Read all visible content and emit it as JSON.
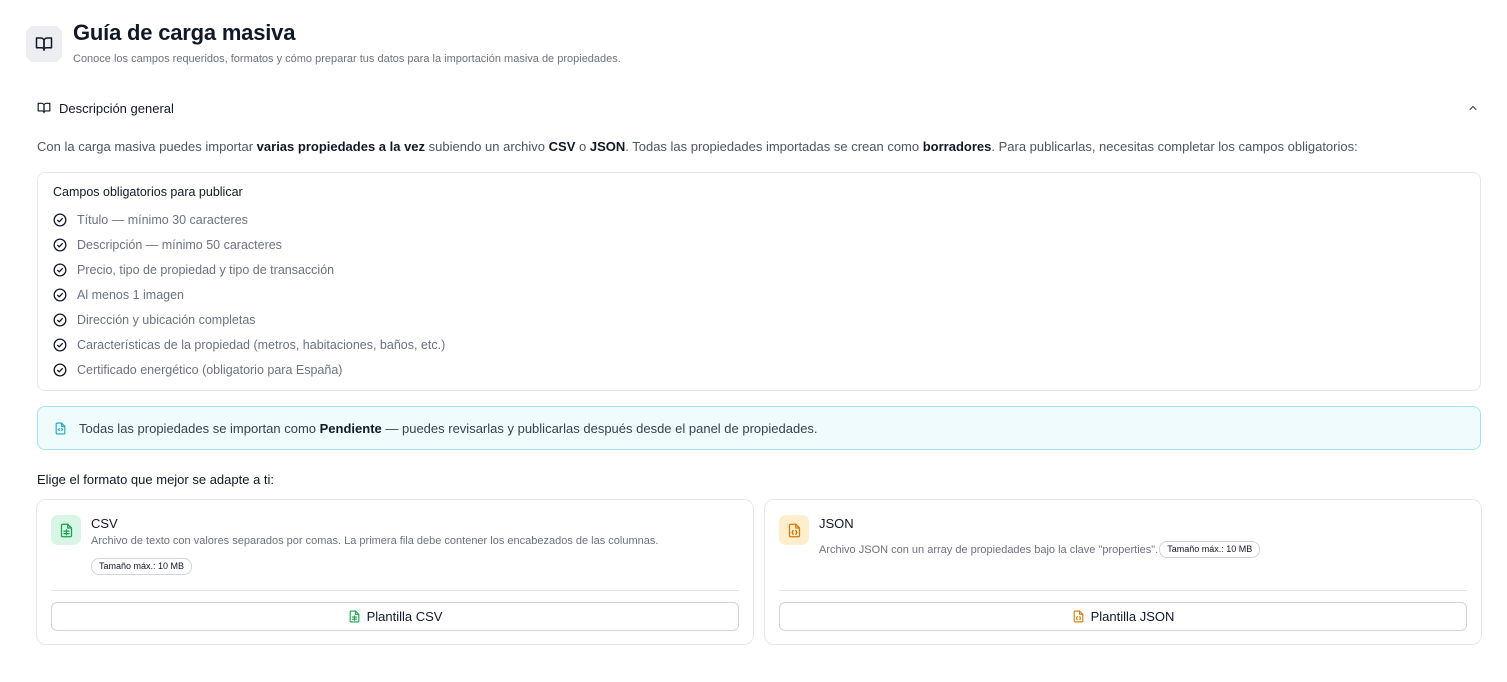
{
  "header": {
    "icon": "book-open-icon",
    "title": "Guía de carga masiva",
    "subtitle": "Conoce los campos requeridos, formatos y cómo preparar tus datos para la importación masiva de propiedades."
  },
  "section": {
    "icon": "book-open-icon",
    "title": "Descripción general",
    "toggle_icon": "chevron-up-icon"
  },
  "intro": {
    "t1": "Con la carga masiva puedes importar ",
    "b1": "varias propiedades a la vez",
    "t2": " subiendo un archivo ",
    "b2": "CSV",
    "t3": " o ",
    "b3": "JSON",
    "t4": ". Todas las propiedades importadas se crean como ",
    "b4": "borradores",
    "t5": ". Para publicarlas, necesitas completar los campos obligatorios:"
  },
  "required": {
    "title": "Campos obligatorios para publicar",
    "items": [
      "Título — mínimo 30 caracteres",
      "Descripción — mínimo 50 caracteres",
      "Precio, tipo de propiedad y tipo de transacción",
      "Al menos 1 imagen",
      "Dirección y ubicación completas",
      "Características de la propiedad (metros, habitaciones, baños, etc.)",
      "Certificado energético (obligatorio para España)"
    ]
  },
  "info": {
    "icon": "file-code-icon",
    "t1": "Todas las propiedades se importan como ",
    "b1": "Pendiente",
    "t2": " — puedes revisarlas y publicarlas después desde el panel de propiedades."
  },
  "choose_label": "Elige el formato que mejor se adapte a ti:",
  "formats": {
    "csv": {
      "icon": "file-spreadsheet-icon",
      "name": "CSV",
      "description": "Archivo de texto con valores separados por comas. La primera fila debe contener los encabezados de las columnas.",
      "size": "Tamaño máx.: 10 MB",
      "button": "Plantilla CSV",
      "color": "#16a34a"
    },
    "json": {
      "icon": "file-json-icon",
      "name": "JSON",
      "description": "Archivo JSON con un array de propiedades bajo la clave \"properties\".",
      "size": "Tamaño máx.: 10 MB",
      "button": "Plantilla JSON",
      "color": "#d97706"
    }
  },
  "colors": {
    "info_border": "#a5e3f3",
    "info_bg": "#f0fbfe"
  }
}
